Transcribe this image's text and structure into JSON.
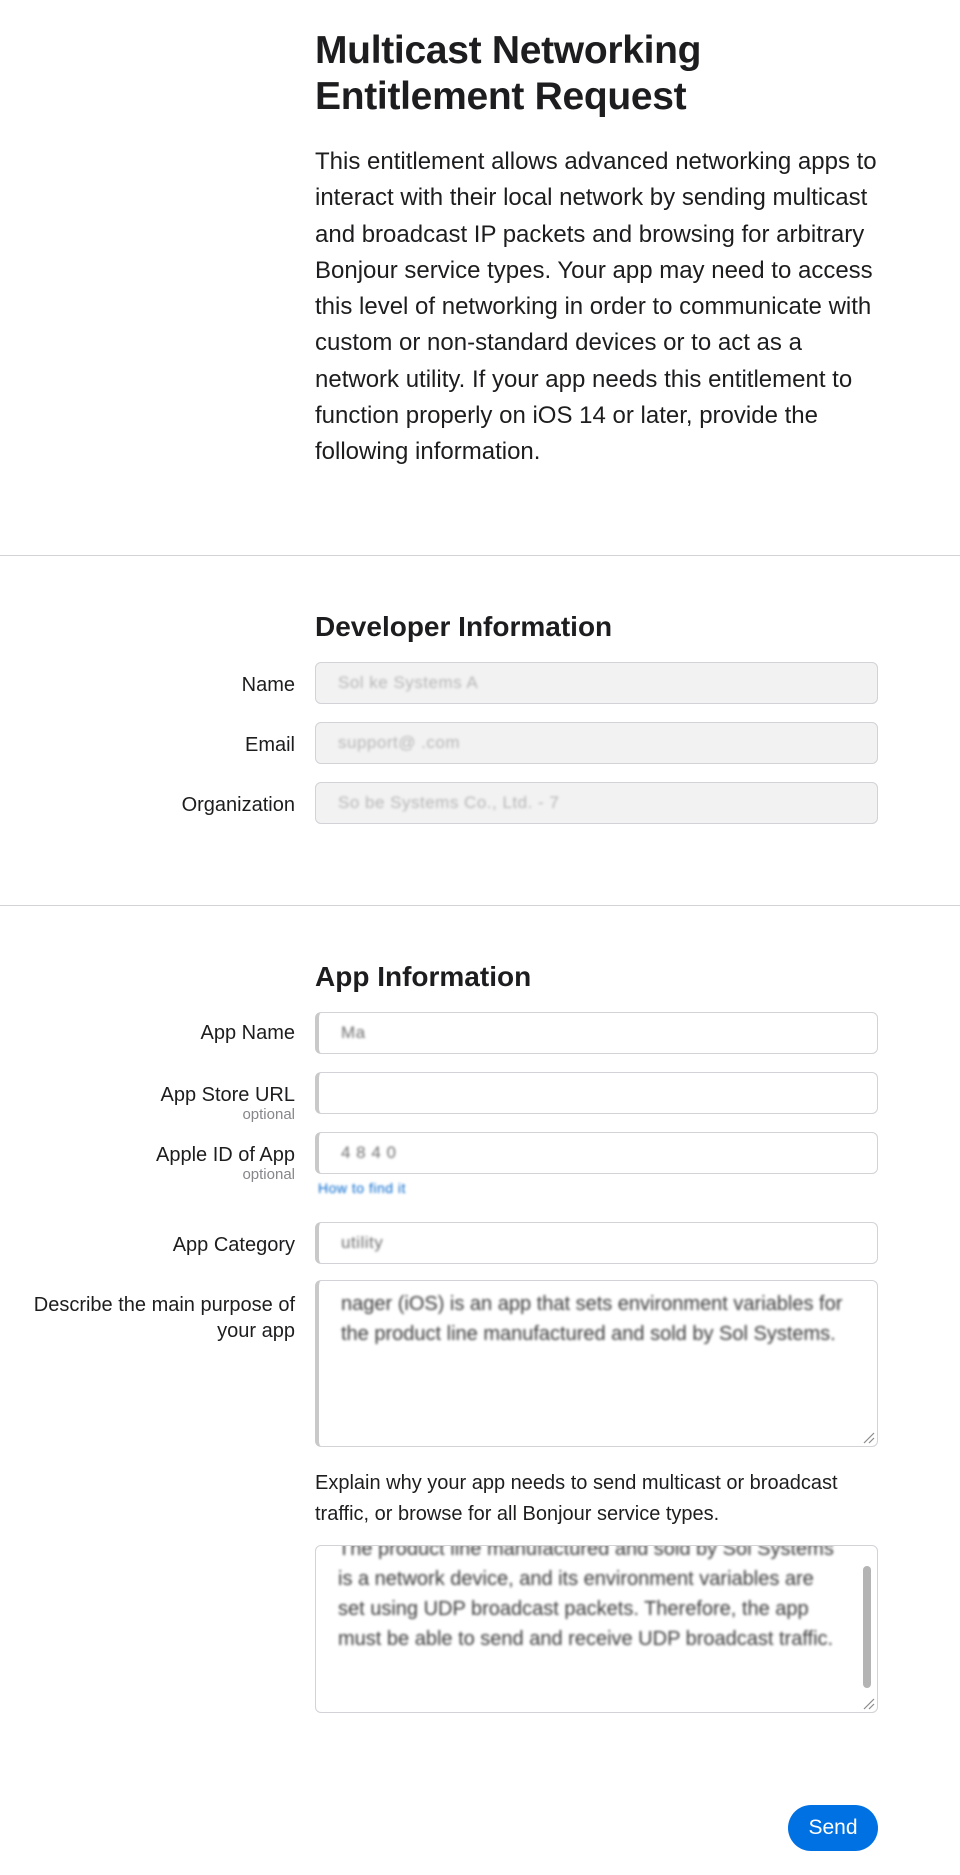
{
  "page": {
    "title": "Multicast Networking Entitlement Request",
    "intro": "This entitlement allows advanced networking apps to interact with their local network by sending multicast and broadcast IP packets and browsing for arbitrary Bonjour service types. Your app may need to access this level of networking in order to communicate with custom or non-standard devices or to act as a network utility. If your app needs this entitlement to function properly on iOS 14 or later, provide the following information."
  },
  "developer": {
    "section_title": "Developer Information",
    "name_label": "Name",
    "name_value": "Sol   ke Systems  A    ",
    "email_label": "Email",
    "email_value": "support@       .com",
    "organization_label": "Organization",
    "organization_value": "So  be Systems Co., Ltd. - 7     "
  },
  "app": {
    "section_title": "App Information",
    "app_name_label": "App Name",
    "app_name_value": "   Ma      ",
    "app_store_url_label": "App Store URL",
    "app_store_url_optional": "optional",
    "app_store_url_value": "",
    "apple_id_label": "Apple ID of App",
    "apple_id_optional": "optional",
    "apple_id_value": "  4   8  4   0",
    "apple_id_help_link": "How to find it",
    "category_label": "App Category",
    "category_value": "utility",
    "purpose_label": "Describe the main purpose of your app",
    "purpose_value": "      nager (iOS) is an app that sets environment variables for the     product line manufactured and sold by Sol    Systems.",
    "explain_label": "Explain why your app needs to send multicast or broadcast traffic, or browse for all Bonjour service types.",
    "explain_value": "The      product line manufactured and sold by Sol   Systems is a network device, and its environment variables are set using UDP broadcast packets. Therefore, the app must be able to send and receive UDP broadcast traffic."
  },
  "actions": {
    "send_label": "Send"
  },
  "colors": {
    "accent": "#0071e3",
    "link": "#0066cc",
    "divider": "#d2d2d7",
    "readonly_bg": "#f2f2f2"
  }
}
